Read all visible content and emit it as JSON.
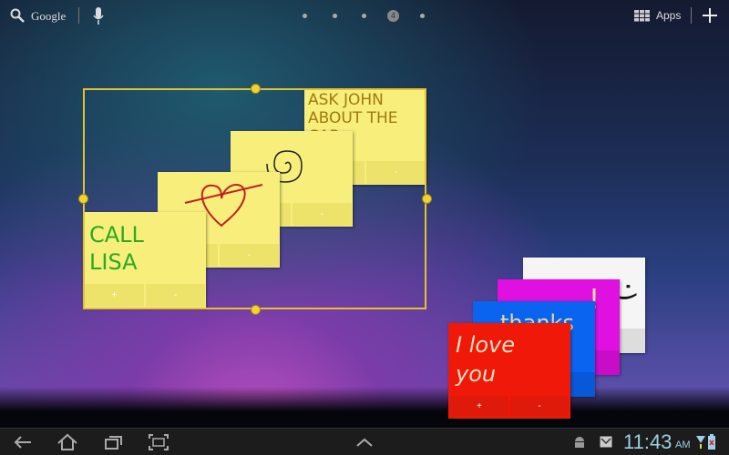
{
  "topbar": {
    "search_label": "Google",
    "page_indicator": "4",
    "apps_label": "Apps"
  },
  "selection_widget": {
    "notes": [
      {
        "text": "ASK JOHN ABOUT THE CAR",
        "color": "#f7ee7c"
      },
      {
        "drawing": "spiral"
      },
      {
        "drawing": "heart"
      },
      {
        "text": "CALL LISA",
        "color": "#f7ee7c"
      }
    ]
  },
  "colored_notes": [
    {
      "color": "#f5f5f5",
      "text": ":)"
    },
    {
      "color": "#e010e0",
      "text": "!"
    },
    {
      "color": "#0a64f0",
      "text": "thanks"
    },
    {
      "color": "#f01808",
      "text": "I love you"
    }
  ],
  "note_buttons": {
    "add": "+",
    "remove": "-"
  },
  "navbar": {
    "time": "11:43",
    "ampm": "AM"
  }
}
